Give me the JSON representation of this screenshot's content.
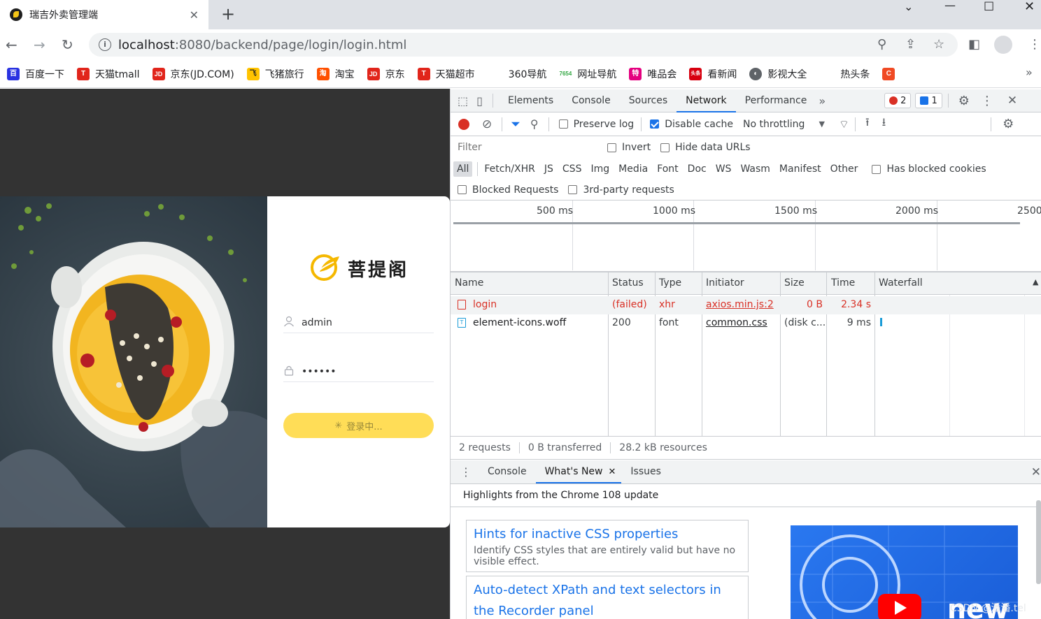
{
  "browser": {
    "tab_title": "瑞吉外卖管理端",
    "tab_close": "✕",
    "new_tab": "+",
    "url_host": "localhost",
    "url_path": ":8080/backend/page/login/login.html",
    "bookmarks": [
      {
        "label": "百度一下",
        "icon": "baidu-icon",
        "color": "#2932e1",
        "glyph": "🐾"
      },
      {
        "label": "天猫tmall",
        "icon": "tmall-icon",
        "color": "#e1251b",
        "glyph": "T"
      },
      {
        "label": "京东(JD.COM)",
        "icon": "jd-icon",
        "color": "#e1251b",
        "glyph": "JD"
      },
      {
        "label": "飞猪旅行",
        "icon": "fliggy-icon",
        "color": "#ffc300",
        "glyph": "飞"
      },
      {
        "label": "淘宝",
        "icon": "taobao-icon",
        "color": "#ff5000",
        "glyph": "淘"
      },
      {
        "label": "京东",
        "icon": "jd-icon-2",
        "color": "#e1251b",
        "glyph": "JD"
      },
      {
        "label": "天猫超市",
        "icon": "tmall-market-icon",
        "color": "#e1251b",
        "glyph": "T"
      },
      {
        "label": "360导航",
        "icon": "",
        "color": "",
        "glyph": ""
      },
      {
        "label": "网址导航",
        "icon": "7654-icon",
        "color": "#35a845",
        "glyph": "7654"
      },
      {
        "label": "唯品会",
        "icon": "vip-icon",
        "color": "#e4007f",
        "glyph": "特"
      },
      {
        "label": "看新闻",
        "icon": "news-icon",
        "color": "#d7000f",
        "glyph": "头条"
      },
      {
        "label": "影视大全",
        "icon": "video-globe-icon",
        "color": "#5f6368",
        "glyph": "◐"
      },
      {
        "label": "热头条",
        "icon": "",
        "color": "",
        "glyph": ""
      }
    ],
    "bookmarks_more": "»"
  },
  "login": {
    "brand": "菩提阁",
    "username": "admin",
    "password": "••••••",
    "button": "登录中..."
  },
  "devtools": {
    "tabs": [
      "Elements",
      "Console",
      "Sources",
      "Network",
      "Performance"
    ],
    "active_tab": "Network",
    "more_tabs": "»",
    "errors": "2",
    "messages": "1",
    "preserve_log": "Preserve log",
    "disable_cache": "Disable cache",
    "throttling": "No throttling",
    "filter_placeholder": "Filter",
    "invert": "Invert",
    "hide_data_urls": "Hide data URLs",
    "types": [
      "All",
      "Fetch/XHR",
      "JS",
      "CSS",
      "Img",
      "Media",
      "Font",
      "Doc",
      "WS",
      "Wasm",
      "Manifest",
      "Other"
    ],
    "has_blocked_cookies": "Has blocked cookies",
    "blocked_requests": "Blocked Requests",
    "third_party": "3rd-party requests",
    "ticks": [
      "500 ms",
      "1000 ms",
      "1500 ms",
      "2000 ms",
      "2500"
    ],
    "columns": [
      "Name",
      "Status",
      "Type",
      "Initiator",
      "Size",
      "Time",
      "Waterfall"
    ],
    "rows": [
      {
        "name": "login",
        "status": "(failed)",
        "type": "xhr",
        "initiator": "axios.min.js:2",
        "size": "0 B",
        "time": "2.34 s",
        "failed": true
      },
      {
        "name": "element-icons.woff",
        "status": "200",
        "type": "font",
        "initiator": "common.css",
        "size": "(disk c...",
        "time": "9 ms",
        "failed": false
      }
    ],
    "summary": [
      "2 requests",
      "0 B transferred",
      "28.2 kB resources"
    ],
    "drawer_tabs": [
      "Console",
      "What's New",
      "Issues"
    ],
    "drawer_active": "What's New",
    "drawer_heading": "Highlights from the Chrome 108 update",
    "tips": [
      {
        "title": "Hints for inactive CSS properties",
        "desc": "Identify CSS styles that are entirely valid but have no visible effect."
      },
      {
        "title": "Auto-detect XPath and text selectors in the Recorder panel",
        "desc": ""
      }
    ],
    "video_text": "new",
    "watermark": "CSDN @潘潘.tel"
  }
}
